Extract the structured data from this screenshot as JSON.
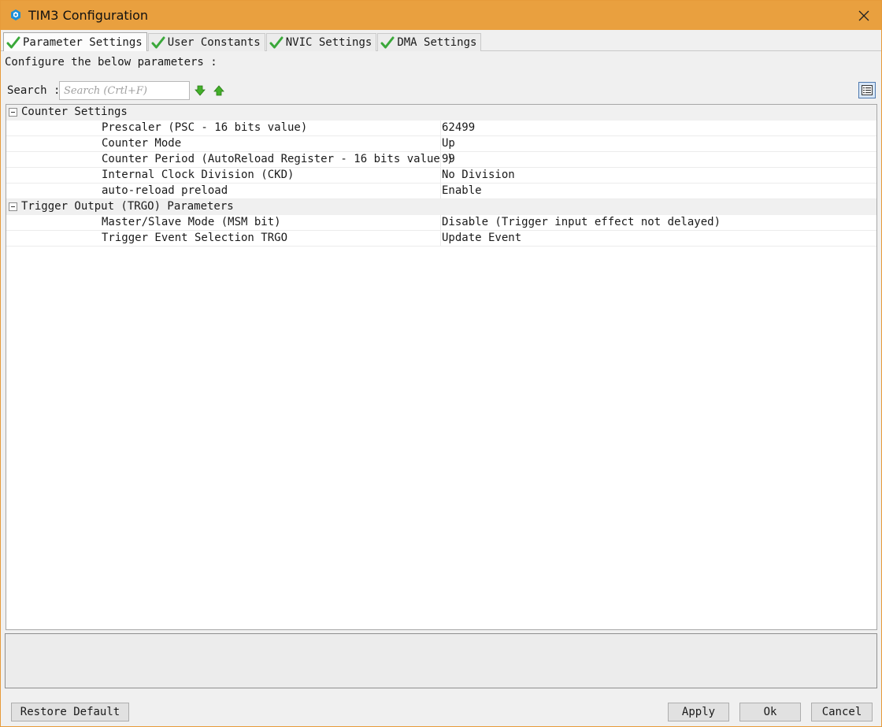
{
  "window": {
    "title": "TIM3 Configuration",
    "accent_color": "#e9a03f"
  },
  "tabs": [
    {
      "label": "Parameter Settings",
      "active": true,
      "icon": "checkmark-icon"
    },
    {
      "label": "User Constants",
      "active": false,
      "icon": "checkmark-icon"
    },
    {
      "label": "NVIC Settings",
      "active": false,
      "icon": "checkmark-icon"
    },
    {
      "label": "DMA Settings",
      "active": false,
      "icon": "checkmark-icon"
    }
  ],
  "panel": {
    "instructions": "Configure the below parameters :",
    "search": {
      "label": "Search :",
      "placeholder": "Search (Crtl+F)",
      "value": ""
    }
  },
  "groups": [
    {
      "label": "Counter Settings",
      "expanded": true,
      "params": [
        {
          "label": "Prescaler (PSC - 16 bits value)",
          "value": "62499"
        },
        {
          "label": "Counter Mode",
          "value": "Up"
        },
        {
          "label": "Counter Period (AutoReload Register - 16 bits value )",
          "value": "99"
        },
        {
          "label": "Internal Clock Division (CKD)",
          "value": "No Division"
        },
        {
          "label": "auto-reload preload",
          "value": "Enable"
        }
      ]
    },
    {
      "label": "Trigger Output (TRGO) Parameters",
      "expanded": true,
      "params": [
        {
          "label": "Master/Slave Mode (MSM bit)",
          "value": "Disable (Trigger input effect not delayed)"
        },
        {
          "label": "Trigger Event Selection TRGO",
          "value": "Update Event"
        }
      ]
    }
  ],
  "buttons": {
    "restore_default": "Restore Default",
    "apply": "Apply",
    "ok": "Ok",
    "cancel": "Cancel"
  }
}
